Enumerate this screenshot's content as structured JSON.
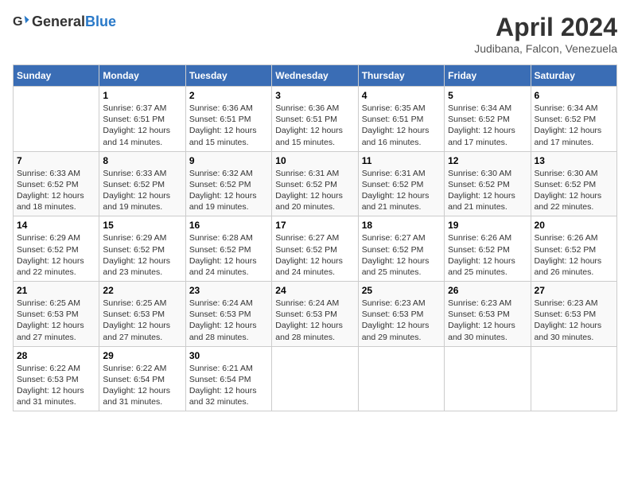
{
  "header": {
    "logo_general": "General",
    "logo_blue": "Blue",
    "title": "April 2024",
    "location": "Judibana, Falcon, Venezuela"
  },
  "days_of_week": [
    "Sunday",
    "Monday",
    "Tuesday",
    "Wednesday",
    "Thursday",
    "Friday",
    "Saturday"
  ],
  "weeks": [
    [
      {
        "day": "",
        "content": ""
      },
      {
        "day": "1",
        "content": "Sunrise: 6:37 AM\nSunset: 6:51 PM\nDaylight: 12 hours\nand 14 minutes."
      },
      {
        "day": "2",
        "content": "Sunrise: 6:36 AM\nSunset: 6:51 PM\nDaylight: 12 hours\nand 15 minutes."
      },
      {
        "day": "3",
        "content": "Sunrise: 6:36 AM\nSunset: 6:51 PM\nDaylight: 12 hours\nand 15 minutes."
      },
      {
        "day": "4",
        "content": "Sunrise: 6:35 AM\nSunset: 6:51 PM\nDaylight: 12 hours\nand 16 minutes."
      },
      {
        "day": "5",
        "content": "Sunrise: 6:34 AM\nSunset: 6:52 PM\nDaylight: 12 hours\nand 17 minutes."
      },
      {
        "day": "6",
        "content": "Sunrise: 6:34 AM\nSunset: 6:52 PM\nDaylight: 12 hours\nand 17 minutes."
      }
    ],
    [
      {
        "day": "7",
        "content": "Sunrise: 6:33 AM\nSunset: 6:52 PM\nDaylight: 12 hours\nand 18 minutes."
      },
      {
        "day": "8",
        "content": "Sunrise: 6:33 AM\nSunset: 6:52 PM\nDaylight: 12 hours\nand 19 minutes."
      },
      {
        "day": "9",
        "content": "Sunrise: 6:32 AM\nSunset: 6:52 PM\nDaylight: 12 hours\nand 19 minutes."
      },
      {
        "day": "10",
        "content": "Sunrise: 6:31 AM\nSunset: 6:52 PM\nDaylight: 12 hours\nand 20 minutes."
      },
      {
        "day": "11",
        "content": "Sunrise: 6:31 AM\nSunset: 6:52 PM\nDaylight: 12 hours\nand 21 minutes."
      },
      {
        "day": "12",
        "content": "Sunrise: 6:30 AM\nSunset: 6:52 PM\nDaylight: 12 hours\nand 21 minutes."
      },
      {
        "day": "13",
        "content": "Sunrise: 6:30 AM\nSunset: 6:52 PM\nDaylight: 12 hours\nand 22 minutes."
      }
    ],
    [
      {
        "day": "14",
        "content": "Sunrise: 6:29 AM\nSunset: 6:52 PM\nDaylight: 12 hours\nand 22 minutes."
      },
      {
        "day": "15",
        "content": "Sunrise: 6:29 AM\nSunset: 6:52 PM\nDaylight: 12 hours\nand 23 minutes."
      },
      {
        "day": "16",
        "content": "Sunrise: 6:28 AM\nSunset: 6:52 PM\nDaylight: 12 hours\nand 24 minutes."
      },
      {
        "day": "17",
        "content": "Sunrise: 6:27 AM\nSunset: 6:52 PM\nDaylight: 12 hours\nand 24 minutes."
      },
      {
        "day": "18",
        "content": "Sunrise: 6:27 AM\nSunset: 6:52 PM\nDaylight: 12 hours\nand 25 minutes."
      },
      {
        "day": "19",
        "content": "Sunrise: 6:26 AM\nSunset: 6:52 PM\nDaylight: 12 hours\nand 25 minutes."
      },
      {
        "day": "20",
        "content": "Sunrise: 6:26 AM\nSunset: 6:52 PM\nDaylight: 12 hours\nand 26 minutes."
      }
    ],
    [
      {
        "day": "21",
        "content": "Sunrise: 6:25 AM\nSunset: 6:53 PM\nDaylight: 12 hours\nand 27 minutes."
      },
      {
        "day": "22",
        "content": "Sunrise: 6:25 AM\nSunset: 6:53 PM\nDaylight: 12 hours\nand 27 minutes."
      },
      {
        "day": "23",
        "content": "Sunrise: 6:24 AM\nSunset: 6:53 PM\nDaylight: 12 hours\nand 28 minutes."
      },
      {
        "day": "24",
        "content": "Sunrise: 6:24 AM\nSunset: 6:53 PM\nDaylight: 12 hours\nand 28 minutes."
      },
      {
        "day": "25",
        "content": "Sunrise: 6:23 AM\nSunset: 6:53 PM\nDaylight: 12 hours\nand 29 minutes."
      },
      {
        "day": "26",
        "content": "Sunrise: 6:23 AM\nSunset: 6:53 PM\nDaylight: 12 hours\nand 30 minutes."
      },
      {
        "day": "27",
        "content": "Sunrise: 6:23 AM\nSunset: 6:53 PM\nDaylight: 12 hours\nand 30 minutes."
      }
    ],
    [
      {
        "day": "28",
        "content": "Sunrise: 6:22 AM\nSunset: 6:53 PM\nDaylight: 12 hours\nand 31 minutes."
      },
      {
        "day": "29",
        "content": "Sunrise: 6:22 AM\nSunset: 6:54 PM\nDaylight: 12 hours\nand 31 minutes."
      },
      {
        "day": "30",
        "content": "Sunrise: 6:21 AM\nSunset: 6:54 PM\nDaylight: 12 hours\nand 32 minutes."
      },
      {
        "day": "",
        "content": ""
      },
      {
        "day": "",
        "content": ""
      },
      {
        "day": "",
        "content": ""
      },
      {
        "day": "",
        "content": ""
      }
    ]
  ]
}
